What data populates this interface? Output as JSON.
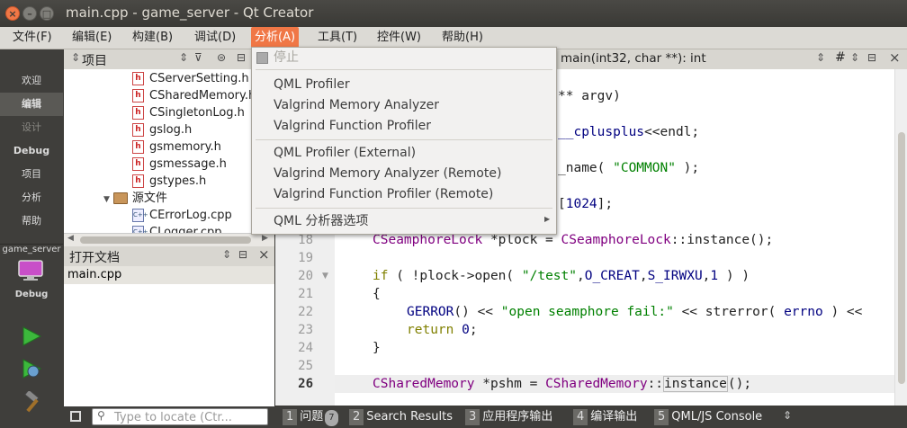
{
  "window": {
    "title": "main.cpp - game_server - Qt Creator"
  },
  "menubar": {
    "items": [
      "文件(F)",
      "编辑(E)",
      "构建(B)",
      "调试(D)",
      "分析(A)",
      "工具(T)",
      "控件(W)",
      "帮助(H)"
    ]
  },
  "analyze_menu": {
    "stop": "停止",
    "items": [
      "QML Profiler",
      "Valgrind Memory Analyzer",
      "Valgrind Function Profiler"
    ],
    "remote_items": [
      "QML Profiler (External)",
      "Valgrind Memory Analyzer (Remote)",
      "Valgrind Function Profiler (Remote)"
    ],
    "submenu": "QML 分析器选项"
  },
  "modebar": {
    "modes": [
      "欢迎",
      "编辑",
      "设计",
      "Debug",
      "项目",
      "分析",
      "帮助"
    ],
    "kit_name": "game_server",
    "kit_build": "Debug"
  },
  "project_panel": {
    "title": "项目",
    "files": [
      "CServerSetting.h",
      "CSharedMemory.h",
      "CSingletonLog.h",
      "gslog.h",
      "gsmemory.h",
      "gsmessage.h",
      "gstypes.h"
    ],
    "source_folder": "源文件",
    "sources": [
      "CErrorLog.cpp",
      "CLogger.cpp"
    ]
  },
  "open_docs": {
    "title": "打开文档",
    "files": [
      "main.cpp"
    ]
  },
  "editor": {
    "function_combo": "main(int32, char **): int",
    "hash": "#",
    "line_numbers": [
      "18",
      "19",
      "20",
      "21",
      "22",
      "23",
      "24",
      "25",
      "26"
    ],
    "current_line": "26",
    "partial_lines": [
      "** argv)",
      "__cplusplus<<endl;",
      "_name( \"COMMON\" );",
      "[1024];"
    ]
  },
  "statusbar": {
    "locate_placeholder": "Type to locate (Ctr...",
    "tabs": [
      {
        "num": "1",
        "label": "问题",
        "badge": "7"
      },
      {
        "num": "2",
        "label": "Search Results"
      },
      {
        "num": "3",
        "label": "应用程序输出"
      },
      {
        "num": "4",
        "label": "编译输出"
      },
      {
        "num": "5",
        "label": "QML/JS Console"
      }
    ]
  },
  "colors": {
    "accent": "#f07746",
    "keyword": "#808000",
    "type": "#800080",
    "string": "#008000",
    "number": "#000080"
  }
}
